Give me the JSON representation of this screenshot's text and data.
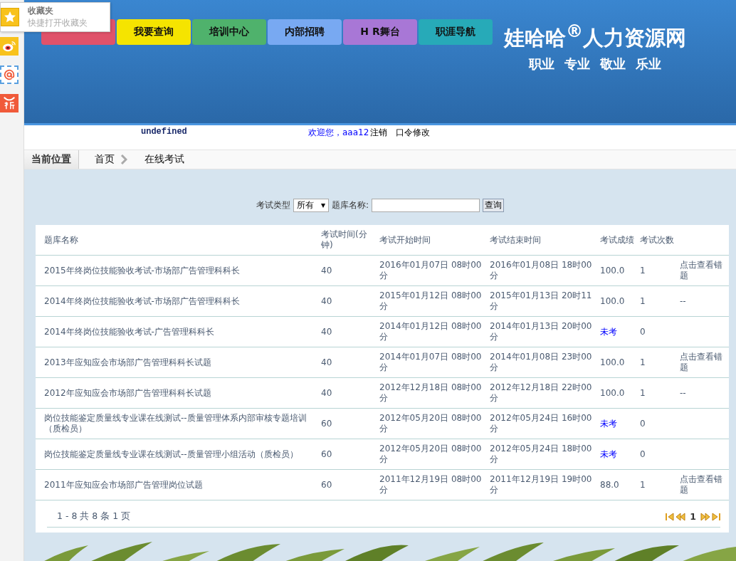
{
  "side_toolbar": {
    "popup": {
      "title": "收藏夹",
      "subtitle": "快捷打开收藏夹"
    }
  },
  "nav": [
    {
      "color": "#e0526a"
    },
    {
      "label": "我要查询",
      "color": "#f5e400"
    },
    {
      "label": "培训中心",
      "color": "#4fb26c"
    },
    {
      "label": "内部招聘",
      "color": "#78a9f2"
    },
    {
      "label": "H R舞台",
      "color": "#a877d6"
    },
    {
      "label": "职涯导航",
      "color": "#27aab8"
    }
  ],
  "logo": {
    "name": "娃哈哈$^{®}$人力资源网",
    "slogan": [
      "职业",
      "专业",
      "敬业",
      "乐业"
    ]
  },
  "user_bar": {
    "dept": "undefined",
    "welcome": "欢迎您，aaa12",
    "logout": "注销",
    "change_password": "口令修改"
  },
  "breadcrumb": {
    "label": "当前位置",
    "items": [
      "首页",
      "在线考试"
    ]
  },
  "search": {
    "type_label": "考试类型",
    "type_value": "所有",
    "name_label": "题库名称:",
    "button": "查询"
  },
  "table": {
    "columns": [
      "题库名称",
      "考试时间(分钟)",
      "考试开始时间",
      "考试结束时间",
      "考试成绩",
      "考试次数"
    ],
    "rows": [
      {
        "name": "2015年终岗位技能验收考试-市场部广告管理科科长",
        "minutes": "40",
        "start": "2016年01月07日 08时00分",
        "end": "2016年01月08日 18时00分",
        "score": "100.0",
        "taken": true,
        "count": "1",
        "action": "点击查看错题"
      },
      {
        "name": "2014年终岗位技能验收考试-市场部广告管理科科长",
        "minutes": "40",
        "start": "2015年01月12日 08时00分",
        "end": "2015年01月13日 20时11分",
        "score": "100.0",
        "taken": true,
        "count": "1",
        "action": "--"
      },
      {
        "name": "2014年终岗位技能验收考试-广告管理科科长",
        "minutes": "40",
        "start": "2014年01月12日 08时00分",
        "end": "2014年01月13日 20时00分",
        "score": "未考",
        "taken": false,
        "count": "0"
      },
      {
        "name": "2013年应知应会市场部广告管理科科长试题",
        "minutes": "40",
        "start": "2014年01月07日 08时00分",
        "end": "2014年01月08日 23时00分",
        "score": "100.0",
        "taken": true,
        "count": "1",
        "action": "点击查看错题"
      },
      {
        "name": "2012年应知应会市场部广告管理科科长试题",
        "minutes": "40",
        "start": "2012年12月18日 08时00分",
        "end": "2012年12月18日 22时00分",
        "score": "100.0",
        "taken": true,
        "count": "1",
        "action": "--"
      },
      {
        "name": "岗位技能鉴定质量线专业课在线测试--质量管理体系内部审核专题培训（质检员）",
        "minutes": "60",
        "start": "2012年05月20日 08时00分",
        "end": "2012年05月24日 16时00分",
        "score": "未考",
        "taken": false,
        "count": "0"
      },
      {
        "name": "岗位技能鉴定质量线专业课在线测试--质量管理小组活动（质检员）",
        "minutes": "60",
        "start": "2012年05月20日 08时00分",
        "end": "2012年05月24日 18时00分",
        "score": "未考",
        "taken": false,
        "count": "0"
      },
      {
        "name": "2011年应知应会市场部广告管理岗位试题",
        "minutes": "60",
        "start": "2011年12月19日 08时00分",
        "end": "2011年12月19日 19时00分",
        "score": "88.0",
        "taken": true,
        "count": "1",
        "action": "点击查看错题"
      }
    ]
  },
  "pager": {
    "summary": "1 - 8 共 8 条 1 页",
    "page": "1"
  }
}
